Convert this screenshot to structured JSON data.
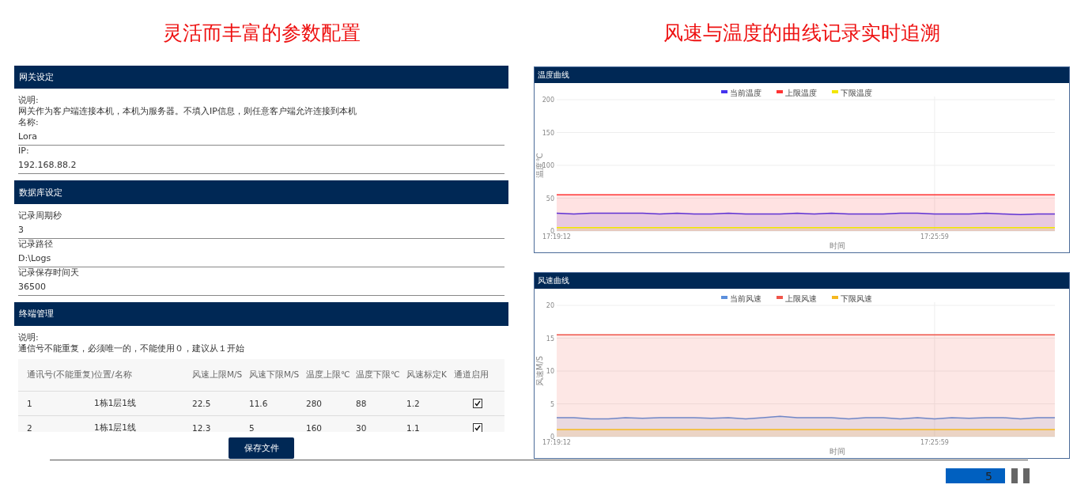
{
  "left_headline": "灵活而丰富的参数配置",
  "right_headline": "风速与温度的曲线记录实时追溯",
  "settings": {
    "sections": [
      {
        "title": "网关设定",
        "note_label": "说明:",
        "note": "网关作为客户端连接本机，本机为服务器。不填入IP信息，则任意客户端允许连接到本机",
        "fields": [
          {
            "label": "名称:",
            "value": "Lora"
          },
          {
            "label": "IP:",
            "value": "192.168.88.2"
          }
        ]
      },
      {
        "title": "数据库设定",
        "fields": [
          {
            "label": "记录周期秒",
            "value": "3"
          },
          {
            "label": "记录路径",
            "value": "D:\\Logs"
          },
          {
            "label": "记录保存时间天",
            "value": "36500"
          }
        ]
      },
      {
        "title": "终端管理",
        "note_label": "说明:",
        "note": "通信号不能重复，必须唯一的，不能使用０，建议从１开始",
        "table": {
          "columns": [
            "通讯号(不能重复)",
            "位置/名称",
            "风速上限M/S",
            "风速下限M/S",
            "温度上限℃",
            "温度下限℃",
            "风速标定K",
            "通道启用"
          ],
          "rows": [
            {
              "cells": [
                "1",
                "1栋1层1线",
                "22.5",
                "11.6",
                "280",
                "88",
                "1.2"
              ],
              "enabled": true
            },
            {
              "cells": [
                "2",
                "1栋1层1线",
                "12.3",
                "5",
                "160",
                "30",
                "1.1"
              ],
              "enabled": true
            }
          ]
        }
      }
    ],
    "save_button": "保存文件"
  },
  "charts": [
    {
      "title": "温度曲线",
      "chart_data": {
        "type": "area",
        "grid": true,
        "legend": "top",
        "xlabel": "时间",
        "ylabel": "温度℃",
        "ylim": [
          0,
          200
        ],
        "yticks": [
          0,
          50,
          100,
          150,
          200
        ],
        "categories": [
          "17:19:12",
          null,
          null,
          null,
          null,
          null,
          null,
          null,
          null,
          null,
          null,
          null,
          null,
          null,
          null,
          null,
          null,
          null,
          null,
          null,
          null,
          null,
          "17:25:59",
          null,
          null,
          null,
          null,
          null,
          null,
          null
        ],
        "series": [
          {
            "name": "当前温度",
            "color": "#4433ee",
            "values": [
              27,
              26,
              27,
              27,
              27,
              27,
              26,
              27,
              26,
              26,
              27,
              26,
              26,
              26,
              27,
              26,
              27,
              26,
              26,
              26,
              27,
              27,
              26,
              26,
              26,
              27,
              26,
              25,
              26,
              26
            ]
          },
          {
            "name": "上限温度",
            "color": "#ff3333",
            "values": [
              55,
              55,
              55,
              55,
              55,
              55,
              55,
              55,
              55,
              55,
              55,
              55,
              55,
              55,
              55,
              55,
              55,
              55,
              55,
              55,
              55,
              55,
              55,
              55,
              55,
              55,
              55,
              55,
              55,
              55
            ]
          },
          {
            "name": "下限温度",
            "color": "#f2e600",
            "values": [
              5,
              5,
              5,
              5,
              5,
              5,
              5,
              5,
              5,
              5,
              5,
              5,
              5,
              5,
              5,
              5,
              5,
              5,
              5,
              5,
              5,
              5,
              5,
              5,
              5,
              5,
              5,
              5,
              5,
              5
            ]
          }
        ]
      }
    },
    {
      "title": "风速曲线",
      "chart_data": {
        "type": "area",
        "grid": true,
        "legend": "top",
        "xlabel": "时间",
        "ylabel": "风速M/S",
        "ylim": [
          0,
          20
        ],
        "yticks": [
          0,
          5,
          10,
          15,
          20
        ],
        "categories": [
          "17:19:12",
          null,
          null,
          null,
          null,
          null,
          null,
          null,
          null,
          null,
          null,
          null,
          null,
          null,
          null,
          null,
          null,
          null,
          null,
          null,
          null,
          null,
          "17:25:59",
          null,
          null,
          null,
          null,
          null,
          null,
          null
        ],
        "series": [
          {
            "name": "当前风速",
            "color": "#5b8fdc",
            "values": [
              2.9,
              2.9,
              2.7,
              2.7,
              2.9,
              2.8,
              2.9,
              2.9,
              2.9,
              2.8,
              2.9,
              2.7,
              2.9,
              3.1,
              2.9,
              2.9,
              2.9,
              2.7,
              2.9,
              2.9,
              2.7,
              2.9,
              2.7,
              2.9,
              2.8,
              2.9,
              2.9,
              2.7,
              2.9,
              2.9
            ]
          },
          {
            "name": "上限风速",
            "color": "#f0554a",
            "values": [
              15.5,
              15.5,
              15.5,
              15.5,
              15.5,
              15.5,
              15.5,
              15.5,
              15.5,
              15.5,
              15.5,
              15.5,
              15.5,
              15.5,
              15.5,
              15.5,
              15.5,
              15.5,
              15.5,
              15.5,
              15.5,
              15.5,
              15.5,
              15.5,
              15.5,
              15.5,
              15.5,
              15.5,
              15.5,
              15.5
            ]
          },
          {
            "name": "下限风速",
            "color": "#f5b820",
            "values": [
              1.1,
              1.1,
              1.1,
              1.1,
              1.1,
              1.1,
              1.1,
              1.1,
              1.1,
              1.1,
              1.1,
              1.1,
              1.1,
              1.1,
              1.1,
              1.1,
              1.1,
              1.1,
              1.1,
              1.1,
              1.1,
              1.1,
              1.1,
              1.1,
              1.1,
              1.1,
              1.1,
              1.1,
              1.1,
              1.1
            ]
          }
        ]
      }
    }
  ],
  "page_number": "5"
}
